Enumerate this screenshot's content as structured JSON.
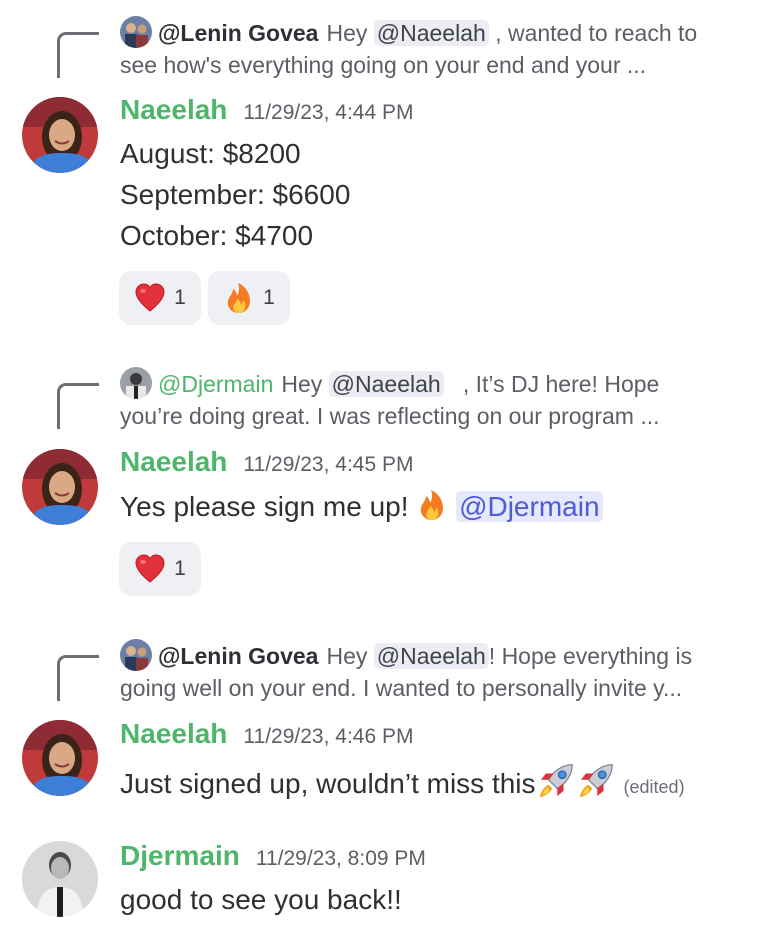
{
  "blocks": [
    {
      "reply": {
        "author": "@Lenin Govea",
        "pre": "Hey",
        "mention": "@Naeelah",
        "post": ", wanted to reach to",
        "line2": "see how's everything going on your end and your ..."
      },
      "author": "Naeelah",
      "timestamp": "11/29/23, 4:44 PM",
      "lines": [
        "August: $8200",
        "September: $6600",
        "October: $4700"
      ],
      "reactions": [
        {
          "emoji": "heart",
          "count": "1"
        },
        {
          "emoji": "fire",
          "count": "1"
        }
      ]
    },
    {
      "reply": {
        "author": "@Djermain",
        "pre": "Hey",
        "mention": "@Naeelah",
        "post": ", It’s DJ here! Hope",
        "line2": "you’re doing great.  I was reflecting on our program ..."
      },
      "author": "Naeelah",
      "timestamp": "11/29/23, 4:45 PM",
      "text": "Yes please sign me up!",
      "mention": "@Djermain",
      "reactions": [
        {
          "emoji": "heart",
          "count": "1"
        }
      ]
    },
    {
      "reply": {
        "author": "@Lenin Govea",
        "pre": "Hey",
        "mention": "@Naeelah",
        "post": "! Hope everything is",
        "line2": "going well on your end.   I wanted to personally invite y..."
      },
      "author": "Naeelah",
      "timestamp": "11/29/23, 4:46 PM",
      "text": "Just signed up, wouldn’t miss this",
      "edited": "(edited)"
    },
    {
      "author": "Djermain",
      "timestamp": "11/29/23, 8:09 PM",
      "text": "good to see you back!!"
    }
  ],
  "colors": {
    "author_green": "#4fb56a",
    "mention_bg": "#e6e8fd",
    "mention_text": "#4f5bd5",
    "reaction_bg": "#eef0f3"
  }
}
